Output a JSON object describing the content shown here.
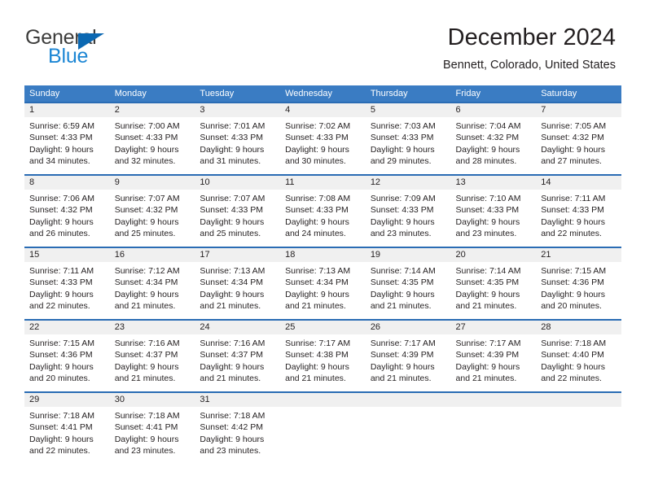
{
  "brand": {
    "name_part1": "General",
    "name_part2": "Blue",
    "triangle_icon": "triangle-icon",
    "accent_dark": "#3c3c3b",
    "accent_blue": "#1c86d4",
    "header_blue": "#3a7cc3"
  },
  "header": {
    "title": "December 2024",
    "subtitle": "Bennett, Colorado, United States"
  },
  "weekdays": [
    "Sunday",
    "Monday",
    "Tuesday",
    "Wednesday",
    "Thursday",
    "Friday",
    "Saturday"
  ],
  "weeks": [
    [
      {
        "day": "1",
        "sunrise": "Sunrise: 6:59 AM",
        "sunset": "Sunset: 4:33 PM",
        "daylight1": "Daylight: 9 hours",
        "daylight2": "and 34 minutes."
      },
      {
        "day": "2",
        "sunrise": "Sunrise: 7:00 AM",
        "sunset": "Sunset: 4:33 PM",
        "daylight1": "Daylight: 9 hours",
        "daylight2": "and 32 minutes."
      },
      {
        "day": "3",
        "sunrise": "Sunrise: 7:01 AM",
        "sunset": "Sunset: 4:33 PM",
        "daylight1": "Daylight: 9 hours",
        "daylight2": "and 31 minutes."
      },
      {
        "day": "4",
        "sunrise": "Sunrise: 7:02 AM",
        "sunset": "Sunset: 4:33 PM",
        "daylight1": "Daylight: 9 hours",
        "daylight2": "and 30 minutes."
      },
      {
        "day": "5",
        "sunrise": "Sunrise: 7:03 AM",
        "sunset": "Sunset: 4:33 PM",
        "daylight1": "Daylight: 9 hours",
        "daylight2": "and 29 minutes."
      },
      {
        "day": "6",
        "sunrise": "Sunrise: 7:04 AM",
        "sunset": "Sunset: 4:32 PM",
        "daylight1": "Daylight: 9 hours",
        "daylight2": "and 28 minutes."
      },
      {
        "day": "7",
        "sunrise": "Sunrise: 7:05 AM",
        "sunset": "Sunset: 4:32 PM",
        "daylight1": "Daylight: 9 hours",
        "daylight2": "and 27 minutes."
      }
    ],
    [
      {
        "day": "8",
        "sunrise": "Sunrise: 7:06 AM",
        "sunset": "Sunset: 4:32 PM",
        "daylight1": "Daylight: 9 hours",
        "daylight2": "and 26 minutes."
      },
      {
        "day": "9",
        "sunrise": "Sunrise: 7:07 AM",
        "sunset": "Sunset: 4:32 PM",
        "daylight1": "Daylight: 9 hours",
        "daylight2": "and 25 minutes."
      },
      {
        "day": "10",
        "sunrise": "Sunrise: 7:07 AM",
        "sunset": "Sunset: 4:33 PM",
        "daylight1": "Daylight: 9 hours",
        "daylight2": "and 25 minutes."
      },
      {
        "day": "11",
        "sunrise": "Sunrise: 7:08 AM",
        "sunset": "Sunset: 4:33 PM",
        "daylight1": "Daylight: 9 hours",
        "daylight2": "and 24 minutes."
      },
      {
        "day": "12",
        "sunrise": "Sunrise: 7:09 AM",
        "sunset": "Sunset: 4:33 PM",
        "daylight1": "Daylight: 9 hours",
        "daylight2": "and 23 minutes."
      },
      {
        "day": "13",
        "sunrise": "Sunrise: 7:10 AM",
        "sunset": "Sunset: 4:33 PM",
        "daylight1": "Daylight: 9 hours",
        "daylight2": "and 23 minutes."
      },
      {
        "day": "14",
        "sunrise": "Sunrise: 7:11 AM",
        "sunset": "Sunset: 4:33 PM",
        "daylight1": "Daylight: 9 hours",
        "daylight2": "and 22 minutes."
      }
    ],
    [
      {
        "day": "15",
        "sunrise": "Sunrise: 7:11 AM",
        "sunset": "Sunset: 4:33 PM",
        "daylight1": "Daylight: 9 hours",
        "daylight2": "and 22 minutes."
      },
      {
        "day": "16",
        "sunrise": "Sunrise: 7:12 AM",
        "sunset": "Sunset: 4:34 PM",
        "daylight1": "Daylight: 9 hours",
        "daylight2": "and 21 minutes."
      },
      {
        "day": "17",
        "sunrise": "Sunrise: 7:13 AM",
        "sunset": "Sunset: 4:34 PM",
        "daylight1": "Daylight: 9 hours",
        "daylight2": "and 21 minutes."
      },
      {
        "day": "18",
        "sunrise": "Sunrise: 7:13 AM",
        "sunset": "Sunset: 4:34 PM",
        "daylight1": "Daylight: 9 hours",
        "daylight2": "and 21 minutes."
      },
      {
        "day": "19",
        "sunrise": "Sunrise: 7:14 AM",
        "sunset": "Sunset: 4:35 PM",
        "daylight1": "Daylight: 9 hours",
        "daylight2": "and 21 minutes."
      },
      {
        "day": "20",
        "sunrise": "Sunrise: 7:14 AM",
        "sunset": "Sunset: 4:35 PM",
        "daylight1": "Daylight: 9 hours",
        "daylight2": "and 21 minutes."
      },
      {
        "day": "21",
        "sunrise": "Sunrise: 7:15 AM",
        "sunset": "Sunset: 4:36 PM",
        "daylight1": "Daylight: 9 hours",
        "daylight2": "and 20 minutes."
      }
    ],
    [
      {
        "day": "22",
        "sunrise": "Sunrise: 7:15 AM",
        "sunset": "Sunset: 4:36 PM",
        "daylight1": "Daylight: 9 hours",
        "daylight2": "and 20 minutes."
      },
      {
        "day": "23",
        "sunrise": "Sunrise: 7:16 AM",
        "sunset": "Sunset: 4:37 PM",
        "daylight1": "Daylight: 9 hours",
        "daylight2": "and 21 minutes."
      },
      {
        "day": "24",
        "sunrise": "Sunrise: 7:16 AM",
        "sunset": "Sunset: 4:37 PM",
        "daylight1": "Daylight: 9 hours",
        "daylight2": "and 21 minutes."
      },
      {
        "day": "25",
        "sunrise": "Sunrise: 7:17 AM",
        "sunset": "Sunset: 4:38 PM",
        "daylight1": "Daylight: 9 hours",
        "daylight2": "and 21 minutes."
      },
      {
        "day": "26",
        "sunrise": "Sunrise: 7:17 AM",
        "sunset": "Sunset: 4:39 PM",
        "daylight1": "Daylight: 9 hours",
        "daylight2": "and 21 minutes."
      },
      {
        "day": "27",
        "sunrise": "Sunrise: 7:17 AM",
        "sunset": "Sunset: 4:39 PM",
        "daylight1": "Daylight: 9 hours",
        "daylight2": "and 21 minutes."
      },
      {
        "day": "28",
        "sunrise": "Sunrise: 7:18 AM",
        "sunset": "Sunset: 4:40 PM",
        "daylight1": "Daylight: 9 hours",
        "daylight2": "and 22 minutes."
      }
    ],
    [
      {
        "day": "29",
        "sunrise": "Sunrise: 7:18 AM",
        "sunset": "Sunset: 4:41 PM",
        "daylight1": "Daylight: 9 hours",
        "daylight2": "and 22 minutes."
      },
      {
        "day": "30",
        "sunrise": "Sunrise: 7:18 AM",
        "sunset": "Sunset: 4:41 PM",
        "daylight1": "Daylight: 9 hours",
        "daylight2": "and 23 minutes."
      },
      {
        "day": "31",
        "sunrise": "Sunrise: 7:18 AM",
        "sunset": "Sunset: 4:42 PM",
        "daylight1": "Daylight: 9 hours",
        "daylight2": "and 23 minutes."
      },
      {
        "day": "",
        "sunrise": "",
        "sunset": "",
        "daylight1": "",
        "daylight2": ""
      },
      {
        "day": "",
        "sunrise": "",
        "sunset": "",
        "daylight1": "",
        "daylight2": ""
      },
      {
        "day": "",
        "sunrise": "",
        "sunset": "",
        "daylight1": "",
        "daylight2": ""
      },
      {
        "day": "",
        "sunrise": "",
        "sunset": "",
        "daylight1": "",
        "daylight2": ""
      }
    ]
  ]
}
